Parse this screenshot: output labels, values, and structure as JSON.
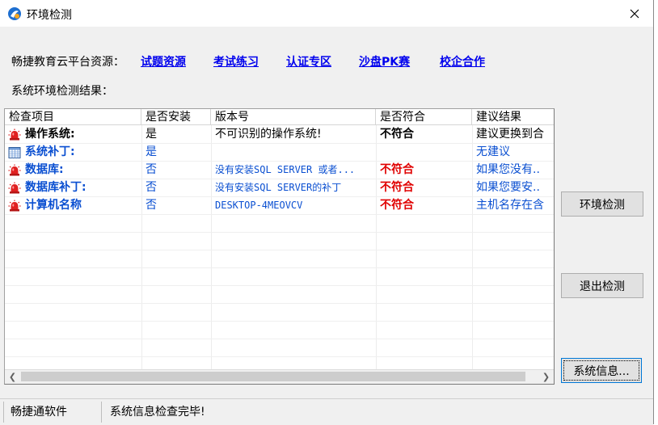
{
  "window": {
    "title": "环境检测"
  },
  "resources": {
    "label": "畅捷教育云平台资源：",
    "links": [
      "试题资源",
      "考试练习",
      "认证专区",
      "沙盘PK赛",
      "校企合作"
    ]
  },
  "result_label": "系统环境检测结果：",
  "table": {
    "columns": [
      "检查项目",
      "是否安装",
      "版本号",
      "是否符合",
      "建议结果"
    ],
    "rows": [
      {
        "icon": "alarm-icon",
        "name": "操作系统:",
        "installed": "是",
        "version": "不可识别的操作系统!",
        "match": "不符合",
        "advice": "建议更换到合",
        "tone": "dark"
      },
      {
        "icon": "calculator-icon",
        "name": "系统补丁:",
        "installed": "是",
        "version": "",
        "match": "",
        "advice": "无建议",
        "tone": "blue"
      },
      {
        "icon": "alarm-icon",
        "name": "数据库:",
        "installed": "否",
        "version": "没有安装SQL SERVER 或者...",
        "match": "不符合",
        "advice": "如果您没有..",
        "tone": "blue"
      },
      {
        "icon": "alarm-icon",
        "name": "数据库补丁:",
        "installed": "否",
        "version": "没有安装SQL SERVER的补丁",
        "match": "不符合",
        "advice": "如果您要安..",
        "tone": "blue"
      },
      {
        "icon": "alarm-icon",
        "name": "计算机名称",
        "installed": "否",
        "version": "DESKTOP-4MEOVCV",
        "match": "不符合",
        "advice": "主机名存在含",
        "tone": "blue"
      }
    ]
  },
  "buttons": {
    "detect": "环境检测",
    "exit": "退出检测",
    "sysinfo": "系统信息..."
  },
  "status": {
    "app": "畅捷通软件",
    "message": "系统信息检查完毕!"
  },
  "colors": {
    "blue_text": "#0a4fd1",
    "red_text": "#e00000",
    "link": "#0000ee"
  }
}
